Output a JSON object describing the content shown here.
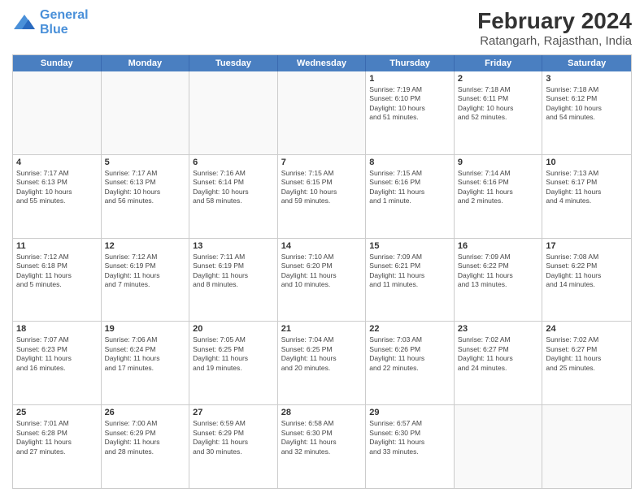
{
  "logo": {
    "line1": "General",
    "line2": "Blue"
  },
  "title": "February 2024",
  "subtitle": "Ratangarh, Rajasthan, India",
  "weekdays": [
    "Sunday",
    "Monday",
    "Tuesday",
    "Wednesday",
    "Thursday",
    "Friday",
    "Saturday"
  ],
  "rows": [
    [
      {
        "day": "",
        "info": ""
      },
      {
        "day": "",
        "info": ""
      },
      {
        "day": "",
        "info": ""
      },
      {
        "day": "",
        "info": ""
      },
      {
        "day": "1",
        "info": "Sunrise: 7:19 AM\nSunset: 6:10 PM\nDaylight: 10 hours\nand 51 minutes."
      },
      {
        "day": "2",
        "info": "Sunrise: 7:18 AM\nSunset: 6:11 PM\nDaylight: 10 hours\nand 52 minutes."
      },
      {
        "day": "3",
        "info": "Sunrise: 7:18 AM\nSunset: 6:12 PM\nDaylight: 10 hours\nand 54 minutes."
      }
    ],
    [
      {
        "day": "4",
        "info": "Sunrise: 7:17 AM\nSunset: 6:13 PM\nDaylight: 10 hours\nand 55 minutes."
      },
      {
        "day": "5",
        "info": "Sunrise: 7:17 AM\nSunset: 6:13 PM\nDaylight: 10 hours\nand 56 minutes."
      },
      {
        "day": "6",
        "info": "Sunrise: 7:16 AM\nSunset: 6:14 PM\nDaylight: 10 hours\nand 58 minutes."
      },
      {
        "day": "7",
        "info": "Sunrise: 7:15 AM\nSunset: 6:15 PM\nDaylight: 10 hours\nand 59 minutes."
      },
      {
        "day": "8",
        "info": "Sunrise: 7:15 AM\nSunset: 6:16 PM\nDaylight: 11 hours\nand 1 minute."
      },
      {
        "day": "9",
        "info": "Sunrise: 7:14 AM\nSunset: 6:16 PM\nDaylight: 11 hours\nand 2 minutes."
      },
      {
        "day": "10",
        "info": "Sunrise: 7:13 AM\nSunset: 6:17 PM\nDaylight: 11 hours\nand 4 minutes."
      }
    ],
    [
      {
        "day": "11",
        "info": "Sunrise: 7:12 AM\nSunset: 6:18 PM\nDaylight: 11 hours\nand 5 minutes."
      },
      {
        "day": "12",
        "info": "Sunrise: 7:12 AM\nSunset: 6:19 PM\nDaylight: 11 hours\nand 7 minutes."
      },
      {
        "day": "13",
        "info": "Sunrise: 7:11 AM\nSunset: 6:19 PM\nDaylight: 11 hours\nand 8 minutes."
      },
      {
        "day": "14",
        "info": "Sunrise: 7:10 AM\nSunset: 6:20 PM\nDaylight: 11 hours\nand 10 minutes."
      },
      {
        "day": "15",
        "info": "Sunrise: 7:09 AM\nSunset: 6:21 PM\nDaylight: 11 hours\nand 11 minutes."
      },
      {
        "day": "16",
        "info": "Sunrise: 7:09 AM\nSunset: 6:22 PM\nDaylight: 11 hours\nand 13 minutes."
      },
      {
        "day": "17",
        "info": "Sunrise: 7:08 AM\nSunset: 6:22 PM\nDaylight: 11 hours\nand 14 minutes."
      }
    ],
    [
      {
        "day": "18",
        "info": "Sunrise: 7:07 AM\nSunset: 6:23 PM\nDaylight: 11 hours\nand 16 minutes."
      },
      {
        "day": "19",
        "info": "Sunrise: 7:06 AM\nSunset: 6:24 PM\nDaylight: 11 hours\nand 17 minutes."
      },
      {
        "day": "20",
        "info": "Sunrise: 7:05 AM\nSunset: 6:25 PM\nDaylight: 11 hours\nand 19 minutes."
      },
      {
        "day": "21",
        "info": "Sunrise: 7:04 AM\nSunset: 6:25 PM\nDaylight: 11 hours\nand 20 minutes."
      },
      {
        "day": "22",
        "info": "Sunrise: 7:03 AM\nSunset: 6:26 PM\nDaylight: 11 hours\nand 22 minutes."
      },
      {
        "day": "23",
        "info": "Sunrise: 7:02 AM\nSunset: 6:27 PM\nDaylight: 11 hours\nand 24 minutes."
      },
      {
        "day": "24",
        "info": "Sunrise: 7:02 AM\nSunset: 6:27 PM\nDaylight: 11 hours\nand 25 minutes."
      }
    ],
    [
      {
        "day": "25",
        "info": "Sunrise: 7:01 AM\nSunset: 6:28 PM\nDaylight: 11 hours\nand 27 minutes."
      },
      {
        "day": "26",
        "info": "Sunrise: 7:00 AM\nSunset: 6:29 PM\nDaylight: 11 hours\nand 28 minutes."
      },
      {
        "day": "27",
        "info": "Sunrise: 6:59 AM\nSunset: 6:29 PM\nDaylight: 11 hours\nand 30 minutes."
      },
      {
        "day": "28",
        "info": "Sunrise: 6:58 AM\nSunset: 6:30 PM\nDaylight: 11 hours\nand 32 minutes."
      },
      {
        "day": "29",
        "info": "Sunrise: 6:57 AM\nSunset: 6:30 PM\nDaylight: 11 hours\nand 33 minutes."
      },
      {
        "day": "",
        "info": ""
      },
      {
        "day": "",
        "info": ""
      }
    ]
  ]
}
